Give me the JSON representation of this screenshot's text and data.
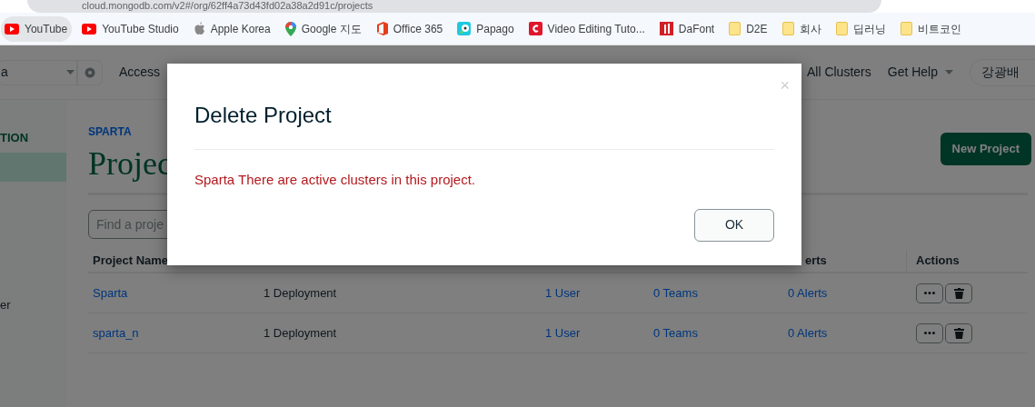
{
  "browser": {
    "url": "cloud.mongodb.com/v2#/org/62ff4a73d43fd02a38a2d91c/projects",
    "bookmarks": [
      {
        "label": "YouTube",
        "kind": "youtube",
        "selected": true
      },
      {
        "label": "YouTube Studio",
        "kind": "youtube",
        "selected": false
      },
      {
        "label": "Apple Korea",
        "kind": "apple",
        "selected": false
      },
      {
        "label": "Google 지도",
        "kind": "maps",
        "selected": false
      },
      {
        "label": "Office 365",
        "kind": "office",
        "selected": false
      },
      {
        "label": "Papago",
        "kind": "papago",
        "selected": false
      },
      {
        "label": "Video Editing Tuto...",
        "kind": "letter-c",
        "selected": false
      },
      {
        "label": "DaFont",
        "kind": "dafont",
        "selected": false
      },
      {
        "label": "D2E",
        "kind": "folder",
        "selected": false
      },
      {
        "label": "회사",
        "kind": "folder",
        "selected": false
      },
      {
        "label": "딥러닝",
        "kind": "folder",
        "selected": false
      },
      {
        "label": "비트코인",
        "kind": "folder",
        "selected": false
      }
    ]
  },
  "topnav": {
    "org": "a",
    "link": "Access",
    "right_links": [
      {
        "label": "All Clusters",
        "dropdown": false
      },
      {
        "label": "Get Help",
        "dropdown": true
      }
    ],
    "user": "강광배"
  },
  "sidebar": {
    "section": "TION",
    "items": [
      {
        "selected": true
      },
      {
        "label": "er",
        "selected": false
      }
    ]
  },
  "breadcrumb": "SPARTA",
  "heading": "Projec",
  "search": {
    "placeholder": "Find a proje"
  },
  "new_button": "New Project",
  "table": {
    "headers": {
      "name": "Project Name",
      "alerts": "erts",
      "actions": "Actions"
    },
    "rows": [
      {
        "name": "Sparta",
        "deployments": "1 Deployment",
        "users": "1 User",
        "teams": "0 Teams",
        "alerts": "0 Alerts"
      },
      {
        "name": "sparta_n",
        "deployments": "1 Deployment",
        "users": "1 User",
        "teams": "0 Teams",
        "alerts": "0 Alerts"
      }
    ]
  },
  "modal": {
    "title": "Delete Project",
    "close": "×",
    "message": "Sparta There are active clusters in this project.",
    "button": "OK"
  }
}
